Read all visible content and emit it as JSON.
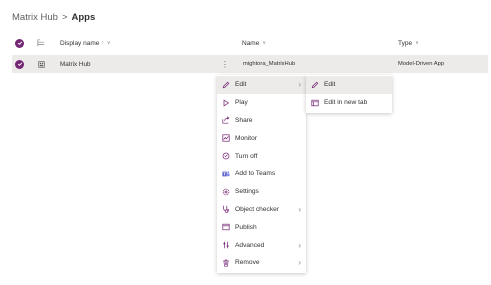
{
  "breadcrumb": {
    "parent": "Matrix Hub",
    "separator": ">",
    "current": "Apps"
  },
  "grid": {
    "columns": [
      {
        "label": "Display name",
        "sort": "↑",
        "caret": "∨"
      },
      {
        "label": "Name",
        "caret": "∨"
      },
      {
        "label": "Type",
        "caret": "∨"
      }
    ],
    "rows": [
      {
        "display_name": "Matrix Hub",
        "name": "mightora_MatrixHub",
        "type": "Model-Driven App"
      }
    ],
    "more_label": "⋮"
  },
  "context_menu": {
    "items": [
      {
        "label": "Edit",
        "icon": "pencil-icon",
        "has_submenu": true,
        "chevron": "›"
      },
      {
        "label": "Play",
        "icon": "play-icon"
      },
      {
        "label": "Share",
        "icon": "share-icon"
      },
      {
        "label": "Monitor",
        "icon": "monitor-icon"
      },
      {
        "label": "Turn off",
        "icon": "power-icon"
      },
      {
        "label": "Add to Teams",
        "icon": "teams-icon"
      },
      {
        "label": "Settings",
        "icon": "gear-icon"
      },
      {
        "label": "Object checker",
        "icon": "stethoscope-icon",
        "has_submenu": true,
        "chevron": "›"
      },
      {
        "label": "Publish",
        "icon": "publish-icon"
      },
      {
        "label": "Advanced",
        "icon": "tools-icon",
        "has_submenu": true,
        "chevron": "›"
      },
      {
        "label": "Remove",
        "icon": "trash-icon",
        "has_submenu": true,
        "chevron": "›"
      }
    ]
  },
  "submenu": {
    "items": [
      {
        "label": "Edit",
        "icon": "pencil-icon"
      },
      {
        "label": "Edit in new tab",
        "icon": "open-in-new-tab-icon"
      }
    ]
  },
  "colors": {
    "accent": "#742774",
    "selected_row": "#edebe9",
    "teams": "#5b5fc7"
  }
}
